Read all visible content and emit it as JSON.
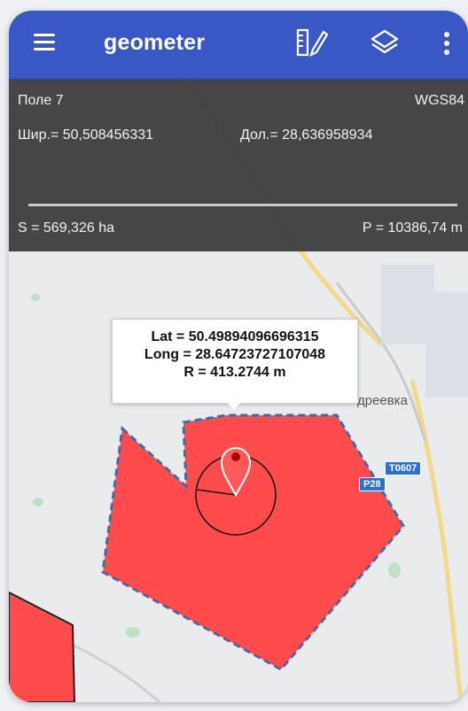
{
  "app": {
    "title": "geometer"
  },
  "toolbar": {
    "menu_icon": "hamburger-menu-icon",
    "measure_icon": "ruler-pencil-icon",
    "layers_icon": "layers-icon",
    "more_icon": "vertical-dots-icon"
  },
  "info": {
    "field_name": "Поле 7",
    "datum": "WGS84",
    "latitude": "Шир.= 50,508456331",
    "longitude": "Дол.= 28,636958934",
    "area": "S = 569,326 ha",
    "perimeter": "P = 10386,74 m"
  },
  "callout": {
    "lat": "Lat = 50.49894096696315",
    "long": "Long = 28.64723727107048",
    "radius": "R = 413.2744 m"
  },
  "map": {
    "place_label": "дреевка",
    "road_badges": [
      "T0607",
      "P28"
    ]
  },
  "colors": {
    "appbar": "#3a57c6",
    "polygon_fill": "#ff4b4b",
    "polygon_stroke": "#3a6ea5",
    "panel_bg": "#3c3c3c"
  }
}
